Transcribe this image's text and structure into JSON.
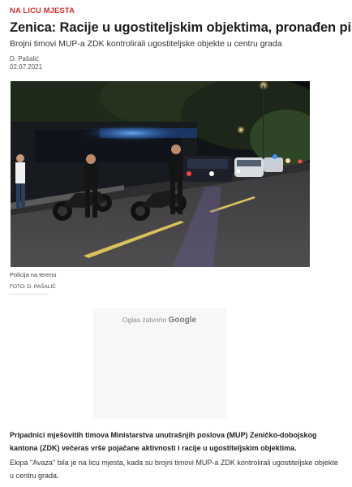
{
  "article": {
    "category": "NA LICU MJESTA",
    "title": "Zenica: Racije u ugostiteljskim objektima, pronađen pištolj",
    "subtitle": "Brojni timovi MUP-a ZDK kontrolirali ugostiteljske objekte u centru grada",
    "author": "D. Pašalić",
    "date": "02.07.2021",
    "image": {
      "caption": "Policija na terenu",
      "credit": "FOTO: D. PAŠALIĆ"
    },
    "ad": {
      "label": "Oglas zatvorio",
      "brand": "Google"
    },
    "paragraphs": [
      "Pripadnici mješovitih timova Ministarstva unutrašnjih poslova (MUP) Zeničko-dobojskog kantona (ZDK) večeras vrše pojačane aktivnosti i racije u ugostiteljskim objektima.",
      "Ekipa \"Avaza\" bila je na licu mjesta, kada su brojni timovi MUP-a ZDK kontrolirali ugostiteljske objekte u centru grada."
    ]
  },
  "colors": {
    "category": "#d32f2f",
    "headline": "#1c1c1c",
    "ad_background": "#f7f7f7"
  }
}
